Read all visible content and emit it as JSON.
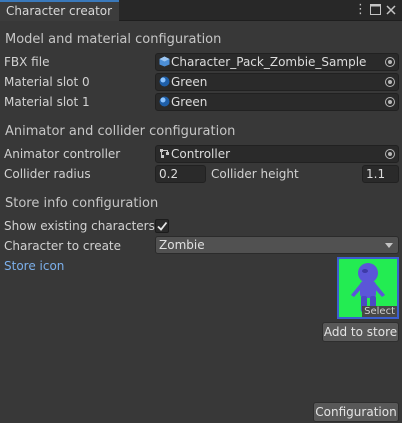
{
  "window": {
    "tab_title": "Character creator",
    "menu_icon": "kebab-menu-icon",
    "maximize_icon": "maximize-icon",
    "close_icon": "close-icon"
  },
  "model_section": {
    "title": "Model and material configuration",
    "fbx_label": "FBX file",
    "fbx_value": "Character_Pack_Zombie_Sample",
    "slot0_label": "Material slot 0",
    "slot0_value": "Green",
    "slot1_label": "Material slot 1",
    "slot1_value": "Green"
  },
  "animator_section": {
    "title": "Animator and collider configuration",
    "controller_label": "Animator controller",
    "controller_value": "Controller",
    "radius_label": "Collider radius",
    "radius_value": "0.2",
    "height_label": "Collider height",
    "height_value": "1.1"
  },
  "store_section": {
    "title": "Store info configuration",
    "show_label": "Show existing characters",
    "show_checked": true,
    "create_label": "Character to create",
    "create_value": "Zombie",
    "icon_label": "Store icon",
    "thumb_select": "Select",
    "add_button": "Add to store"
  },
  "footer": {
    "config_button": "Configuration"
  },
  "colors": {
    "background": "#383838",
    "accent": "#3a79bb",
    "link": "#7bafea",
    "thumbnail_bg": "#23ec52",
    "character": "#5b56d8"
  }
}
